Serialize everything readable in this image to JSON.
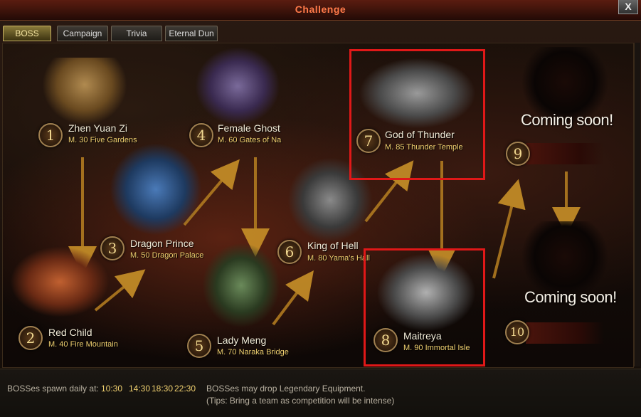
{
  "window": {
    "title": "Challenge",
    "close_label": "X"
  },
  "tabs": [
    {
      "label": "BOSS",
      "active": true
    },
    {
      "label": "Campaign"
    },
    {
      "label": "Trivia"
    },
    {
      "label": "Eternal Dun"
    }
  ],
  "bosses": [
    {
      "num": "1",
      "name": "Zhen Yuan Zi",
      "level": "M. 30 Five Gardens"
    },
    {
      "num": "2",
      "name": "Red Child",
      "level": "M. 40 Fire Mountain"
    },
    {
      "num": "3",
      "name": "Dragon Prince",
      "level": "M. 50 Dragon Palace"
    },
    {
      "num": "4",
      "name": "Female Ghost",
      "level": "M. 60 Gates of Na"
    },
    {
      "num": "5",
      "name": "Lady Meng",
      "level": "M. 70 Naraka Bridge"
    },
    {
      "num": "6",
      "name": "King of Hell",
      "level": "M. 80 Yama's Hall"
    },
    {
      "num": "7",
      "name": "God of Thunder",
      "level": "M. 85 Thunder Temple"
    },
    {
      "num": "8",
      "name": "Maitreya",
      "level": "M. 90 Immortal Isle"
    },
    {
      "num": "9",
      "name": "Coming soon!"
    },
    {
      "num": "10",
      "name": "Coming soon!"
    }
  ],
  "footer": {
    "spawn_label": "BOSSes spawn daily at:",
    "times": [
      "10:30",
      "14:30",
      "18:30",
      "22:30"
    ],
    "drop_text": "BOSSes may drop Legendary Equipment.",
    "tip_text": "(Tips: Bring a team as competition will be intense)"
  },
  "colors": {
    "highlight": "#e01818",
    "accent_gold": "#f0d070",
    "title": "#ff7a4a"
  }
}
